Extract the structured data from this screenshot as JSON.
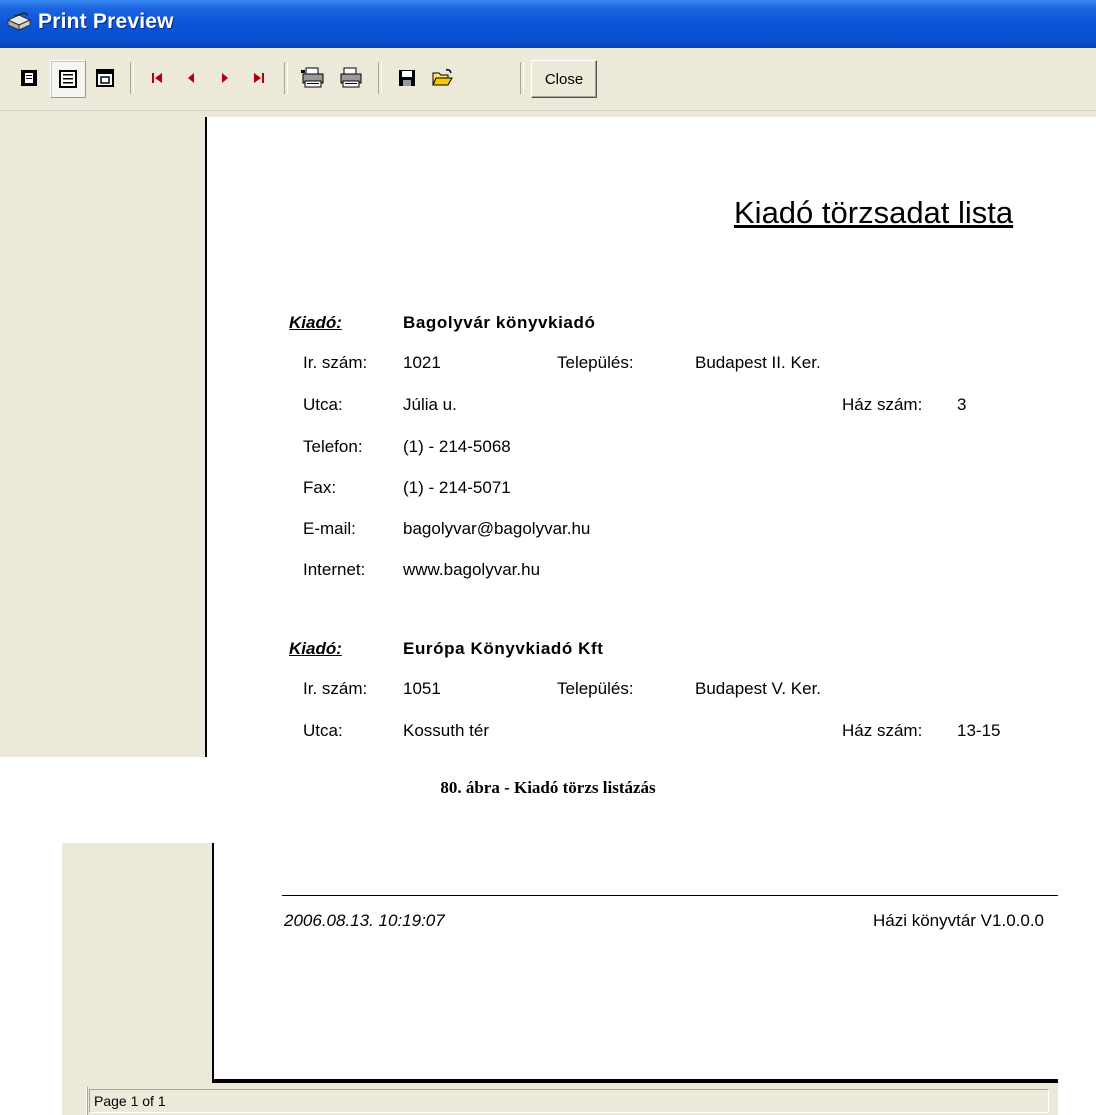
{
  "window": {
    "title": "Print Preview"
  },
  "toolbar": {
    "close_label": "Close"
  },
  "report": {
    "title": "Kiadó törzsadat lista",
    "field_labels": {
      "kiado": "Kiadó:",
      "zip": "Ir. szám:",
      "city": "Település:",
      "street": "Utca:",
      "house": "Ház szám:",
      "phone": "Telefon:",
      "fax": "Fax:",
      "email": "E-mail:",
      "internet": "Internet:"
    },
    "publishers": [
      {
        "name": "Bagolyvár könyvkiadó",
        "zip": "1021",
        "city": "Budapest II. Ker.",
        "street": "Júlia u.",
        "house": "3",
        "phone": "(1) - 214-5068",
        "fax": "(1) - 214-5071",
        "email": "bagolyvar@bagolyvar.hu",
        "internet": "www.bagolyvar.hu"
      },
      {
        "name": "Európa Könyvkiadó Kft",
        "zip": "1051",
        "city": "Budapest V. Ker.",
        "street": "Kossuth tér",
        "house": "13-15"
      }
    ],
    "footer": {
      "datetime": "2006.08.13. 10:19:07",
      "app": "Házi könyvtár V1.0.0.0"
    }
  },
  "caption": "80. ábra - Kiadó törzs listázás",
  "status": {
    "page": "Page 1 of 1"
  }
}
